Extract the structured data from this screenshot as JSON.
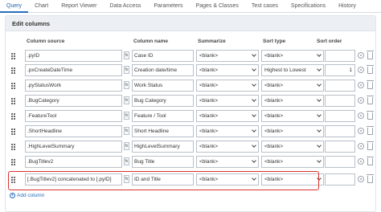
{
  "tabs": [
    "Query",
    "Chart",
    "Report Viewer",
    "Data Access",
    "Parameters",
    "Pages & Classes",
    "Test cases",
    "Specifications",
    "History"
  ],
  "panel_title": "Edit columns",
  "headers": {
    "source": "Column source",
    "name": "Column name",
    "summarize": "Summarize",
    "sort_type": "Sort type",
    "sort_order": "Sort order"
  },
  "rows": [
    {
      "source": ".pyID",
      "name": "Case ID",
      "summarize": "<blank>",
      "sort_type": "<blank>",
      "sort_order": ""
    },
    {
      "source": ".pxCreateDateTime",
      "name": "Creation date/time",
      "summarize": "<blank>",
      "sort_type": "Highest to Lowest",
      "sort_order": "1"
    },
    {
      "source": ".pyStatusWork",
      "name": "Work Status",
      "summarize": "<blank>",
      "sort_type": "<blank>",
      "sort_order": ""
    },
    {
      "source": ".BugCategory",
      "name": "Bug Category",
      "summarize": "<blank>",
      "sort_type": "<blank>",
      "sort_order": ""
    },
    {
      "source": ".FeatureTool",
      "name": "Feature / Tool",
      "summarize": "<blank>",
      "sort_type": "<blank>",
      "sort_order": ""
    },
    {
      "source": ".ShortHeadline",
      "name": "Short Headline",
      "summarize": "<blank>",
      "sort_type": "<blank>",
      "sort_order": ""
    },
    {
      "source": ".HighLevelSummary",
      "name": "HighLevelSummary",
      "summarize": "<blank>",
      "sort_type": "<blank>",
      "sort_order": ""
    },
    {
      "source": ".BugTitlev2",
      "name": "Bug Title",
      "summarize": "<blank>",
      "sort_type": "<blank>",
      "sort_order": ""
    },
    {
      "source": "[.BugTitlev2] concatenated to [.pyID]",
      "name": "ID and Title",
      "summarize": "<blank>",
      "sort_type": "<blank>",
      "sort_order": ""
    }
  ],
  "add_column_label": "Add column",
  "icons": {
    "fx": "fx-icon",
    "gear": "gear-icon",
    "trash": "trash-icon",
    "handle": "drag-handle-icon",
    "plus": "plus-icon"
  },
  "colors": {
    "accent": "#2a6ebb",
    "highlight": "#d6332e"
  }
}
